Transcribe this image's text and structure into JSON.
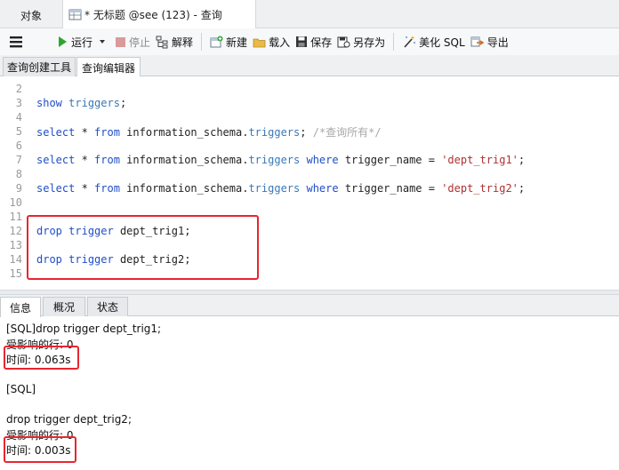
{
  "tabs": {
    "objects": "对象",
    "query": "* 无标题 @see (123) - 查询"
  },
  "toolbar": {
    "run": "运行",
    "stop": "停止",
    "explain": "解释",
    "new": "新建",
    "load": "载入",
    "save": "保存",
    "save_as": "另存为",
    "beautify": "美化 SQL",
    "export": "导出"
  },
  "subtabs": {
    "builder": "查询创建工具",
    "editor": "查询编辑器"
  },
  "editor": {
    "line_numbers": [
      "2",
      "3",
      "4",
      "5",
      "6",
      "7",
      "8",
      "9",
      "10",
      "11",
      "12",
      "13",
      "14",
      "15"
    ],
    "tokens": {
      "show": "show",
      "triggers": "triggers",
      "semicolon": ";",
      "select": "select",
      "star": " * ",
      "from": "from",
      "schema": " information_schema.",
      "comment": "/*查询所有*/",
      "where": "where",
      "cond": " trigger_name = ",
      "trig1_str": "'dept_trig1'",
      "trig2_str": "'dept_trig2'",
      "drop": "drop",
      "trigger": "trigger",
      "trig1": " dept_trig1;",
      "trig2": " dept_trig2;"
    }
  },
  "results": {
    "tabs": [
      "信息",
      "概况",
      "状态"
    ],
    "messages": [
      "[SQL]drop trigger dept_trig1;",
      "受影响的行: 0",
      "时间: 0.063s",
      "[SQL]",
      "drop trigger dept_trig2;",
      "受影响的行: 0",
      "时间: 0.003s"
    ]
  },
  "colors": {
    "highlight_box": "#e8262e",
    "keyword": "#1f4ec7",
    "string": "#b03030",
    "run_icon": "#2ea52e"
  }
}
